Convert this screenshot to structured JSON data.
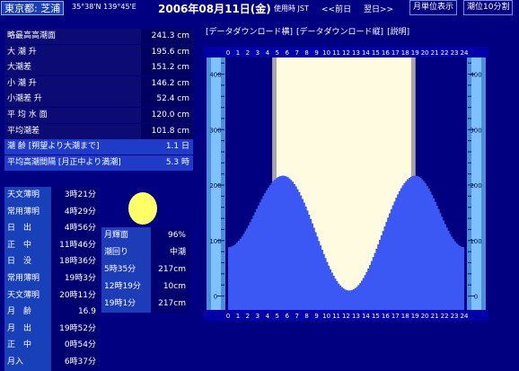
{
  "header": {
    "location": "東京都: 芝浦",
    "coords": "35°38'N 139°45'E",
    "date": "2006年08月11日(金)",
    "time_mode": "使用時 JST",
    "prev_day": "<<前日",
    "next_day": "翌日>>",
    "month_view": "月単位表示",
    "tide_10min": "潮位10分割"
  },
  "links": {
    "download_h": "[データダウンロード横]",
    "download_v": "[データダウンロード縦]",
    "help": "[説明]"
  },
  "stats": [
    {
      "label": "略最高高潮面",
      "value": "241.3 cm"
    },
    {
      "label": "大 潮 升",
      "value": "195.6 cm"
    },
    {
      "label": "大潮差",
      "value": "151.2 cm"
    },
    {
      "label": "小 潮 升",
      "value": "146.2 cm"
    },
    {
      "label": "小潮差 升",
      "value": "52.4 cm"
    },
    {
      "label": "平 均 水 面",
      "value": "120.0 cm"
    },
    {
      "label": "平均潮差",
      "value": "101.8 cm"
    },
    {
      "label": "潮 齢 [朔望より大潮まで]",
      "value": "1.1 日"
    },
    {
      "label": "平均高潮間隔 [月正中より満潮]",
      "value": "5.3 時"
    }
  ],
  "astro": [
    {
      "label": "天文薄明",
      "value": "3時21分"
    },
    {
      "label": "常用薄明",
      "value": "4時29分"
    },
    {
      "label": "日　出",
      "value": "4時56分"
    },
    {
      "label": "正　中",
      "value": "11時46分"
    },
    {
      "label": "日　没",
      "value": "18時36分"
    },
    {
      "label": "常用薄明",
      "value": "19時3分"
    },
    {
      "label": "天文薄明",
      "value": "20時11分"
    },
    {
      "label": "月　齢",
      "value": "16.9"
    },
    {
      "label": "月　出",
      "value": "19時52分"
    },
    {
      "label": "正　中",
      "value": "0時54分"
    },
    {
      "label": "月入",
      "value": "6時37分"
    }
  ],
  "tide_info": [
    {
      "label": "月輝面",
      "value": "96%"
    },
    {
      "label": "潮回り",
      "value": "中潮"
    },
    {
      "label": "5時35分",
      "value": "217cm"
    },
    {
      "label": "12時19分",
      "value": "10cm"
    },
    {
      "label": "19時1分",
      "value": "217cm"
    }
  ],
  "colors": {
    "background": "#000080",
    "water": "#3b57f4",
    "daylight": "#fffbe0",
    "twilight": "#a6a6a6",
    "moon": "#ffff66",
    "ruler_band": "#4a8fd8"
  },
  "chart_data": {
    "type": "area",
    "x_ticks": [
      "0",
      "1",
      "2",
      "3",
      "4",
      "5",
      "6",
      "7",
      "8",
      "9",
      "10",
      "11",
      "12",
      "13",
      "14",
      "15",
      "16",
      "17",
      "18",
      "19",
      "20",
      "21",
      "22",
      "23",
      "24"
    ],
    "y_ticks": [
      "400",
      "300",
      "200",
      "100",
      "0"
    ],
    "ylim": [
      -25,
      430
    ],
    "xlim": [
      0,
      24
    ],
    "high_tides": [
      {
        "time": 5.58,
        "height": 217
      },
      {
        "time": 19.02,
        "height": 217
      }
    ],
    "low_tides": [
      {
        "time": 12.32,
        "height": 10
      }
    ],
    "start_height": 88,
    "end_height": 88,
    "sunrise": 4.93,
    "sunset": 18.6,
    "twilight_start": 4.48,
    "twilight_end": 19.05
  }
}
